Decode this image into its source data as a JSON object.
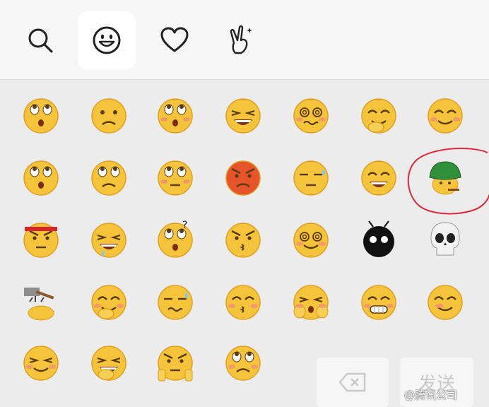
{
  "tabs": [
    {
      "name": "search-icon"
    },
    {
      "name": "smiley-icon",
      "active": true
    },
    {
      "name": "heart-icon"
    },
    {
      "name": "peace-hand-icon"
    }
  ],
  "emojis": [
    {
      "name": "emoji-pouting"
    },
    {
      "name": "emoji-sad"
    },
    {
      "name": "emoji-shy-eyes-up"
    },
    {
      "name": "emoji-crying-loudly"
    },
    {
      "name": "emoji-dizzy-sweat"
    },
    {
      "name": "emoji-hand-over-mouth"
    },
    {
      "name": "emoji-smile"
    },
    {
      "name": "emoji-surprised"
    },
    {
      "name": "emoji-eyes-up"
    },
    {
      "name": "emoji-eye-roll"
    },
    {
      "name": "emoji-angry-red"
    },
    {
      "name": "emoji-awkward-sweat"
    },
    {
      "name": "emoji-grin"
    },
    {
      "name": "emoji-green-hat-cigar"
    },
    {
      "name": "emoji-headband"
    },
    {
      "name": "emoji-drooling-angry"
    },
    {
      "name": "emoji-question"
    },
    {
      "name": "emoji-shush"
    },
    {
      "name": "emoji-spiral-eyes"
    },
    {
      "name": "emoji-black-bomb"
    },
    {
      "name": "emoji-skull"
    },
    {
      "name": "emoji-hammer-hit"
    },
    {
      "name": "emoji-chin-stroke"
    },
    {
      "name": "emoji-sweat-deadpan"
    },
    {
      "name": "emoji-kiss"
    },
    {
      "name": "emoji-cover-face"
    },
    {
      "name": "emoji-braces-grin"
    },
    {
      "name": "emoji-tilted-blush"
    },
    {
      "name": "emoji-side-glance"
    },
    {
      "name": "emoji-finger-face"
    },
    {
      "name": "emoji-arms-flex"
    },
    {
      "name": "emoji-pleading"
    }
  ],
  "buttons": {
    "delete": {
      "icon": "backspace-icon"
    },
    "send": {
      "label": "发送"
    }
  },
  "watermark": {
    "text": "@腾讯公司"
  },
  "annotation": {
    "color": "#e0283c"
  }
}
